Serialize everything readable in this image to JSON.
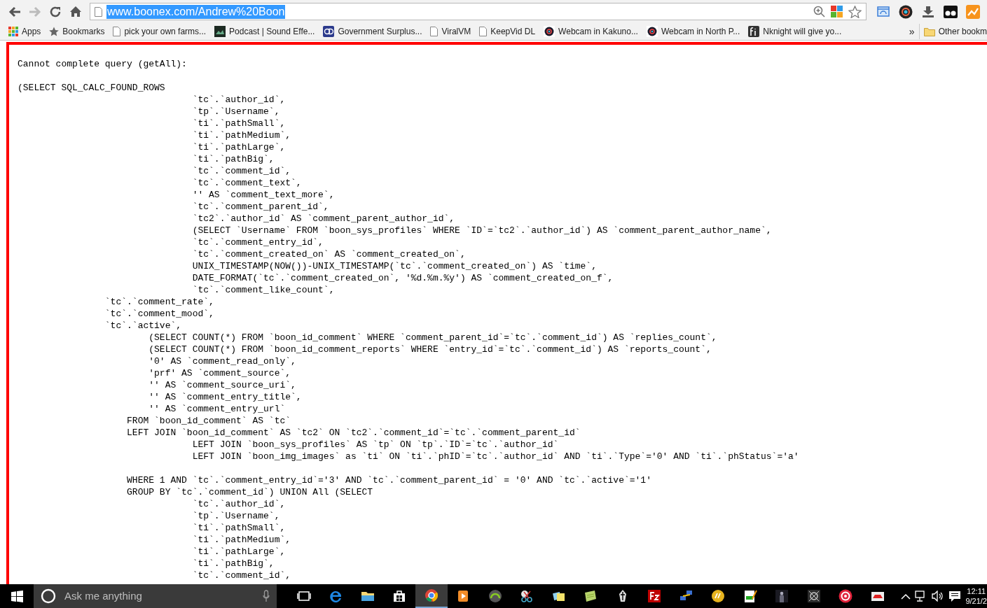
{
  "browser": {
    "address": {
      "text": "www.boonex.com/Andrew%20Boon",
      "selected": true
    },
    "bookmarks": [
      {
        "label": "Apps",
        "kind": "apps"
      },
      {
        "label": "Bookmarks",
        "kind": "star"
      },
      {
        "label": "pick your own farms...",
        "kind": "page"
      },
      {
        "label": "Podcast | Sound Effe...",
        "kind": "podcast"
      },
      {
        "label": "Government Surplus...",
        "kind": "gd"
      },
      {
        "label": "ViralVM",
        "kind": "page"
      },
      {
        "label": "KeepVid DL",
        "kind": "page"
      },
      {
        "label": "Webcam in Kakuno...",
        "kind": "webcam"
      },
      {
        "label": "Webcam in North P...",
        "kind": "webcam"
      },
      {
        "label": "Nknight will give yo...",
        "kind": "fi"
      }
    ],
    "overflow": "»",
    "other_bookmarks": "Other bookm"
  },
  "error": {
    "heading": "Cannot complete query (getAll):",
    "blocks": [
      [
        "(SELECT SQL_CALC_FOUND_ROWS",
        "                                `tc`.`author_id`,",
        "                                `tp`.`Username`,",
        "                                `ti`.`pathSmall`,",
        "                                `ti`.`pathMedium`,",
        "                                `ti`.`pathLarge`,",
        "                                `ti`.`pathBig`,",
        "                                `tc`.`comment_id`,",
        "                                `tc`.`comment_text`,",
        "                                '' AS `comment_text_more`,",
        "                                `tc`.`comment_parent_id`,",
        "                                `tc2`.`author_id` AS `comment_parent_author_id`,",
        "                                (SELECT `Username` FROM `boon_sys_profiles` WHERE `ID`=`tc2`.`author_id`) AS `comment_parent_author_name`,",
        "                                `tc`.`comment_entry_id`,",
        "                                `tc`.`comment_created_on` AS `comment_created_on`,",
        "                                UNIX_TIMESTAMP(NOW())-UNIX_TIMESTAMP(`tc`.`comment_created_on`) AS `time`,",
        "                                DATE_FORMAT(`tc`.`comment_created_on`, '%d.%m.%y') AS `comment_created_on_f`,",
        "                                `tc`.`comment_like_count`,",
        "                `tc`.`comment_rate`,",
        "                `tc`.`comment_mood`,",
        "                `tc`.`active`,",
        "                        (SELECT COUNT(*) FROM `boon_id_comment` WHERE `comment_parent_id`=`tc`.`comment_id`) AS `replies_count`,",
        "                        (SELECT COUNT(*) FROM `boon_id_comment_reports` WHERE `entry_id`=`tc`.`comment_id`) AS `reports_count`,",
        "                        '0' AS `comment_read_only`,",
        "                        'prf' AS `comment_source`,",
        "                        '' AS `comment_source_uri`,",
        "                        '' AS `comment_entry_title`,",
        "                        '' AS `comment_entry_url`",
        "                    FROM `boon_id_comment` AS `tc`",
        "                    LEFT JOIN `boon_id_comment` AS `tc2` ON `tc2`.`comment_id`=`tc`.`comment_parent_id`",
        "                                LEFT JOIN `boon_sys_profiles` AS `tp` ON `tp`.`ID`=`tc`.`author_id`",
        "                                LEFT JOIN `boon_img_images` as `ti` ON `ti`.`phID`=`tc`.`author_id` AND `ti`.`Type`='0' AND `ti`.`phStatus`='a'"
      ],
      [
        "                    WHERE 1 AND `tc`.`comment_entry_id`='3' AND `tc`.`comment_parent_id` = '0' AND `tc`.`active`='1'",
        "                    GROUP BY `tc`.`comment_id`) UNION All (SELECT",
        "                                `tc`.`author_id`,",
        "                                `tp`.`Username`,",
        "                                `ti`.`pathSmall`,",
        "                                `ti`.`pathMedium`,",
        "                                `ti`.`pathLarge`,",
        "                                `ti`.`pathBig`,",
        "                                `tc`.`comment_id`,"
      ]
    ]
  },
  "taskbar": {
    "search_placeholder": "Ask me anything",
    "apps": [
      {
        "selected": false
      },
      {
        "selected": false
      },
      {
        "selected": false
      },
      {
        "selected": false
      },
      {
        "selected": true
      },
      {
        "selected": false
      },
      {
        "selected": false
      },
      {
        "selected": false
      },
      {
        "selected": false
      },
      {
        "selected": false
      },
      {
        "selected": false
      },
      {
        "selected": false
      },
      {
        "selected": false
      },
      {
        "selected": false
      },
      {
        "selected": false
      },
      {
        "selected": false
      },
      {
        "selected": false
      },
      {
        "selected": false
      },
      {
        "selected": false
      }
    ],
    "time": "12:11",
    "date": "9/21/2"
  }
}
